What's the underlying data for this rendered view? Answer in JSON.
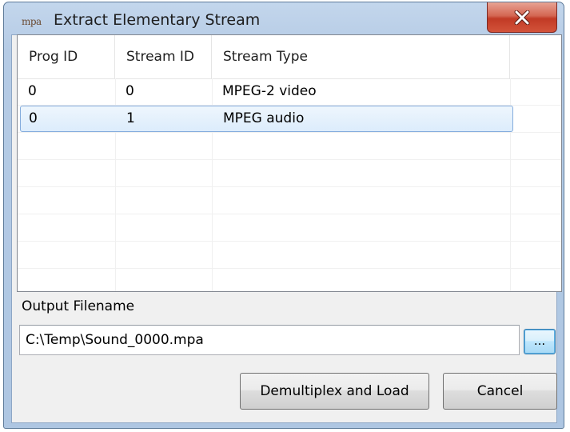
{
  "window": {
    "title": "Extract Elementary Stream",
    "app_icon_text": "mpa"
  },
  "table": {
    "columns": [
      "Prog ID",
      "Stream ID",
      "Stream Type"
    ],
    "rows": [
      {
        "prog_id": "0",
        "stream_id": "0",
        "stream_type": "MPEG-2 video",
        "selected": false
      },
      {
        "prog_id": "0",
        "stream_id": "1",
        "stream_type": "MPEG audio",
        "selected": true
      }
    ]
  },
  "output": {
    "label": "Output Filename",
    "filename": "C:\\Temp\\Sound_0000.mpa",
    "browse_label": "..."
  },
  "buttons": {
    "demux_label": "Demultiplex and Load",
    "cancel_label": "Cancel"
  },
  "colors": {
    "selection_border": "#84acdd",
    "close_button": "#c13a25"
  }
}
